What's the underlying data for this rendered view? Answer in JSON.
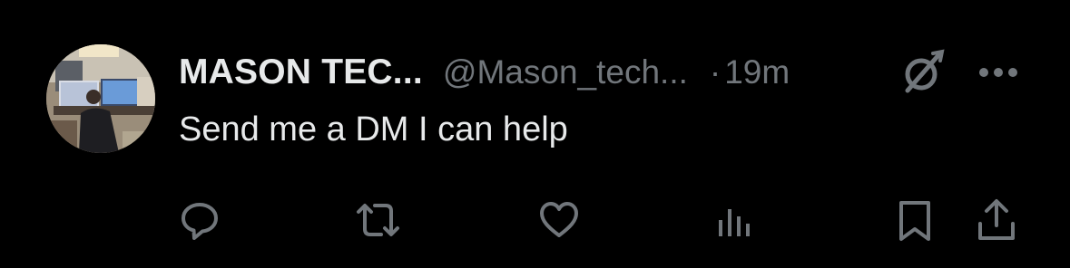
{
  "post": {
    "author_name": "MASON TEC...",
    "handle": "@Mason_tech...",
    "separator": "·",
    "time": "19m",
    "text": "Send me a DM I can help"
  },
  "icons": {
    "avatar": "avatar",
    "grok": "grok-icon",
    "more": "more-icon",
    "reply": "reply-icon",
    "repost": "repost-icon",
    "like": "like-icon",
    "views": "views-icon",
    "bookmark": "bookmark-icon",
    "share": "share-icon"
  },
  "colors": {
    "background": "#000000",
    "primary_text": "#e7e9ea",
    "secondary_text": "#71767b"
  }
}
